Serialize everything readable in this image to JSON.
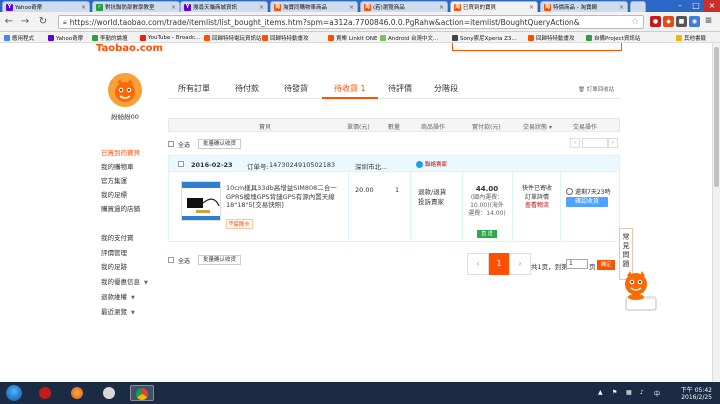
{
  "browser": {
    "tabs": [
      {
        "label": "Yahoo奇摩",
        "fav_text": "Y",
        "fav_color": "#6001d2"
      },
      {
        "label": "對抗聯防部數學教室",
        "fav_text": "✓",
        "fav_color": "#2e9e3e"
      },
      {
        "label": "搜尋天貓商城資訊",
        "fav_text": "Y",
        "fav_color": "#6001d2"
      },
      {
        "label": "淘寶同購物車商品",
        "fav_text": "淘",
        "fav_color": "#ff5000"
      },
      {
        "label": "(若)瀏覽商品",
        "fav_text": "淘",
        "fav_color": "#ff5000"
      },
      {
        "label": "已買到的寶貝",
        "fav_text": "淘",
        "fav_color": "#ff5000"
      },
      {
        "label": "特價商品 - 淘寶網",
        "fav_text": "淘",
        "fav_color": "#ff5000"
      }
    ],
    "url": "https://world.taobao.com/trade/itemlist/list_bought_items.htm?spm=a312a.7700846.0.0.PgRahw&action=itemlist/BoughtQueryAction&",
    "bookmarks": [
      {
        "label": "應用程式",
        "color": "#4285f4"
      },
      {
        "label": "Yahoo奇摩",
        "color": "#6001d2"
      },
      {
        "label": "李勤的論壇",
        "color": "#2e9e3e"
      },
      {
        "label": "YouTube - Broadc...",
        "color": "#e62117"
      },
      {
        "label": "回歸特特電玩資訊站",
        "color": "#ff5000"
      },
      {
        "label": "回歸特特動畫攻",
        "color": "#ff5000"
      },
      {
        "label": "賣樂 LinkIt ONE",
        "color": "#ff5000"
      },
      {
        "label": "Android 台灣中文...",
        "color": "#78c257"
      },
      {
        "label": "Sony索尼Xperia Z3...",
        "color": "#444444"
      },
      {
        "label": "回歸特特動畫攻",
        "color": "#ff5000"
      },
      {
        "label": "自備Project資訊站",
        "color": "#2e9e3e"
      },
      {
        "label": "其他書籤",
        "color": "#f5b400"
      }
    ]
  },
  "page": {
    "logo": "Taobao.com",
    "username": "紛紛紛00",
    "sidebar": [
      "已買到的寶貝",
      "我的購物車",
      "官方集運",
      "我的足標",
      "購買過的店鋪",
      "我的支付寶",
      "評價管理",
      "我的足跡",
      "我的優惠信息",
      "退款維權",
      "最近瀏覽"
    ],
    "tabs": [
      "所有訂單",
      "待付款",
      "待發貨",
      "待收貨 1",
      "待評價",
      "分階段"
    ],
    "recycle_label": "訂單回收站",
    "headers": [
      "寶貝",
      "單價(元)",
      "數量",
      "商品操作",
      "實付款(元)",
      "交易狀態",
      "交易操作"
    ],
    "select_all": "全选",
    "batch_confirm": "批量确认收货",
    "order": {
      "date": "2016-02-23",
      "order_no_label": "订单号:",
      "order_no": "1473024910502183",
      "shop": "深圳市北...",
      "contact": "聯絡賣家",
      "title": "10cm樣具33db高增益SIM808二合一GPRS模塊GPS背鏈GPS有源內置天線18\"18\"5[交易快照]",
      "protect": "保障卡",
      "price": "20.00",
      "qty": "1",
      "ops": [
        "退款/退貨",
        "投訴賣家"
      ],
      "total": "44.00",
      "ship_note": "(國內運費：10.00)(海外運費：14.00)",
      "pay_method": "直 送",
      "status": [
        "快件已寄收",
        "訂單詳情",
        "查看物流"
      ],
      "countdown": "還剩7天23時",
      "confirm": "確認收貨"
    },
    "pager": {
      "current": "1",
      "info_prefix": "共1页，到第",
      "page_input": "1",
      "info_suffix": "页",
      "go": "确定",
      "prev": "‹",
      "next": "›"
    },
    "help_label": "常見問題"
  },
  "taskbar": {
    "time": "下午 05:42",
    "date": "2016/2/25"
  }
}
